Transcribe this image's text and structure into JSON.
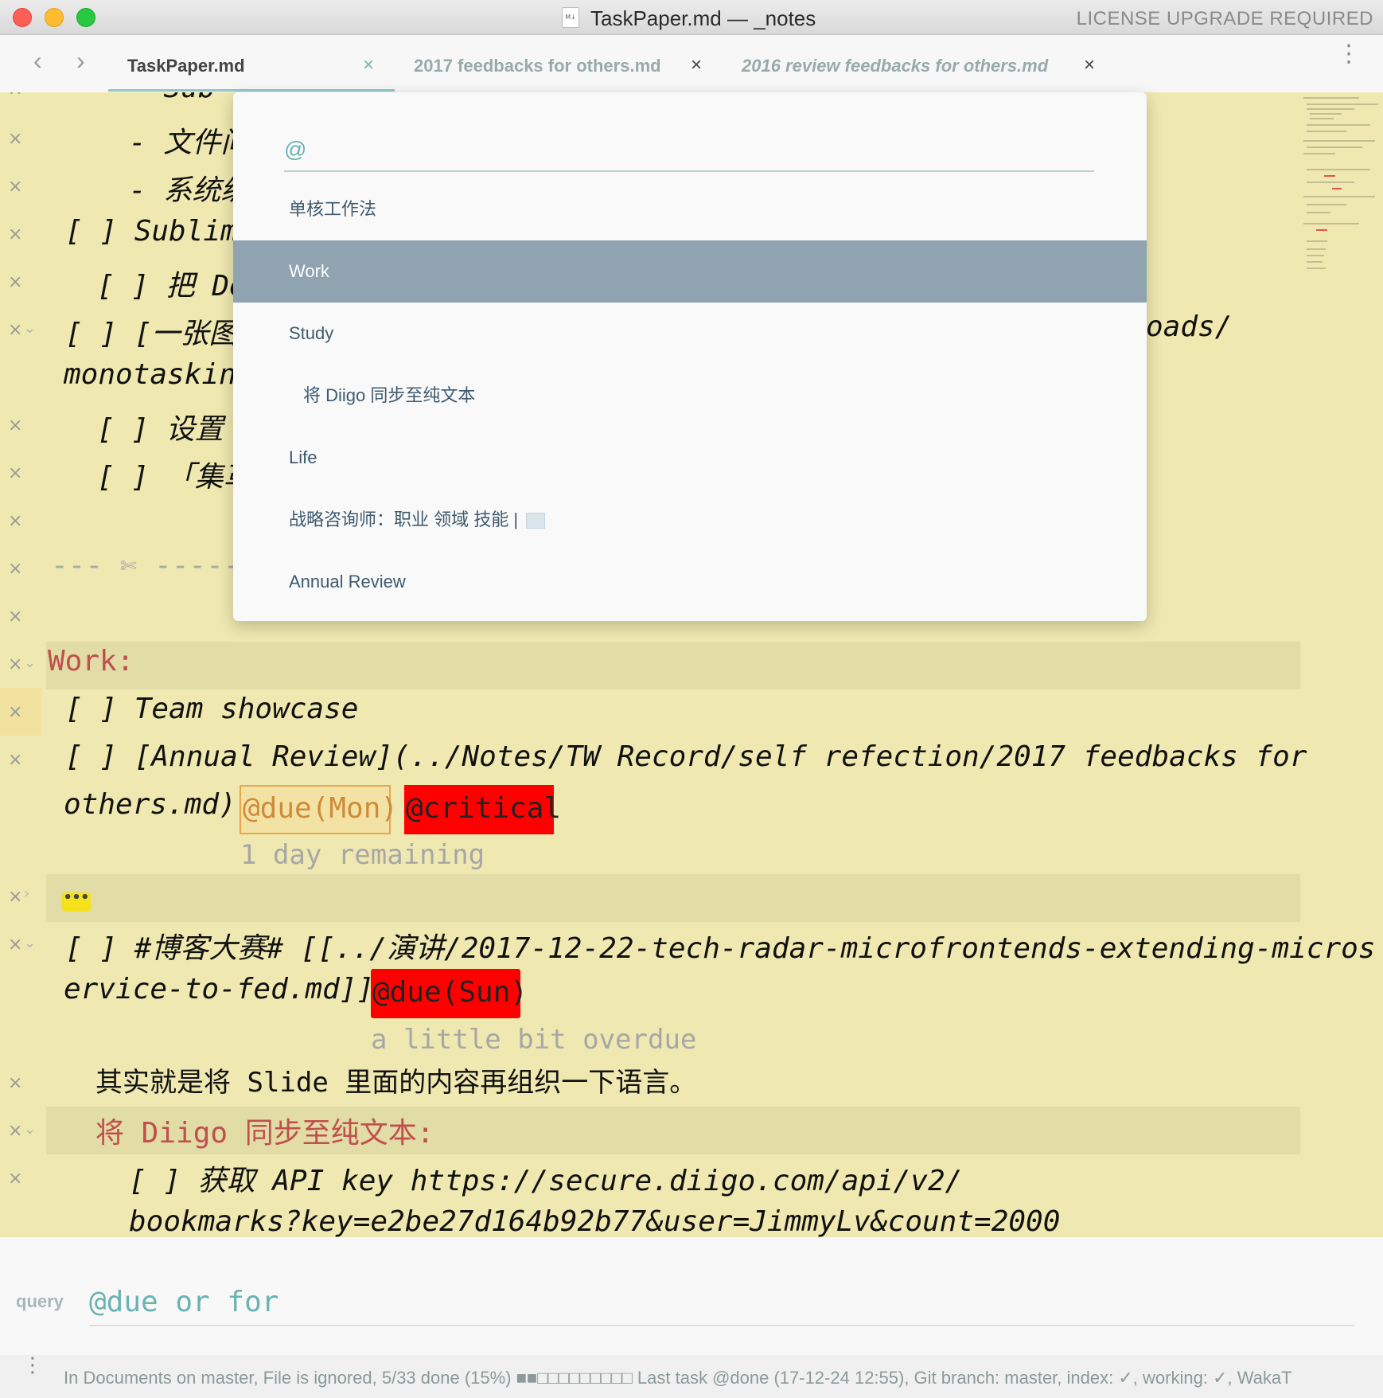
{
  "window": {
    "title": "TaskPaper.md — _notes",
    "doc_icon": "M↓",
    "license": "LICENSE UPGRADE REQUIRED"
  },
  "tabs": {
    "back": "‹",
    "forward": "›",
    "items": [
      {
        "label": "TaskPaper.md",
        "close": "×"
      },
      {
        "label": "2017 feedbacks for others.md",
        "close": "×"
      },
      {
        "label": "2016 review feedbacks for others.md",
        "close": "×"
      }
    ],
    "more": "⋮"
  },
  "editor": {
    "lines": [
      "- Sub",
      "- 文件间",
      "- 系统级",
      "[ ] Sublime",
      "[ ] 把 De",
      "[ ] [一张图",
      "oads/",
      "monotasking",
      "[ ] 设置",
      "[ ] 「集革",
      "--- ✄ -----",
      "Work:",
      "[ ] Team showcase",
      "[ ] [Annual Review](../Notes/TW Record/self refection/2017 feedbacks for",
      "others.md)",
      "1 day remaining",
      "[ ] #博客大赛# [[../演讲/2017-12-22-tech-radar-microfrontends-extending-micros",
      "ervice-to-fed.md]]",
      "a little bit overdue",
      "其实就是将 Slide 里面的内容再组织一下语言。",
      "将 Diigo 同步至纯文本:",
      "[ ] 获取 API key https://secure.diigo.com/api/v2/",
      "bookmarks?key=e2be27d164b92b77&user=JimmyLv&count=2000"
    ],
    "tags": {
      "due_mon": "@due(Mon)",
      "critical": "@critical",
      "due_sun": "@due(Sun)",
      "ellipsis": "•••"
    },
    "gutter_x": "×",
    "gutter_fold": "⌄",
    "gutter_collapsed": "›",
    "colors": {
      "background": "#efe8b0",
      "header": "#c0504d",
      "critical": "#ff0000"
    }
  },
  "popup": {
    "input_value": "@",
    "items": [
      "单核工作法",
      "Work",
      "Study",
      "将 Diigo 同步至纯文本",
      "Life",
      "战略咨询师：职业 领域 技能 |",
      "Annual Review"
    ],
    "selected": "Work"
  },
  "query": {
    "label": "query",
    "value": "@due or for"
  },
  "status": {
    "dots": "⋮",
    "text": "In Documents on master, File is ignored, 5/33 done (15%) ■■□□□□□□□□□ Last task @done (17-12-24 12:55), Git branch: master, index: ✓, working: ✓, WakaT"
  }
}
